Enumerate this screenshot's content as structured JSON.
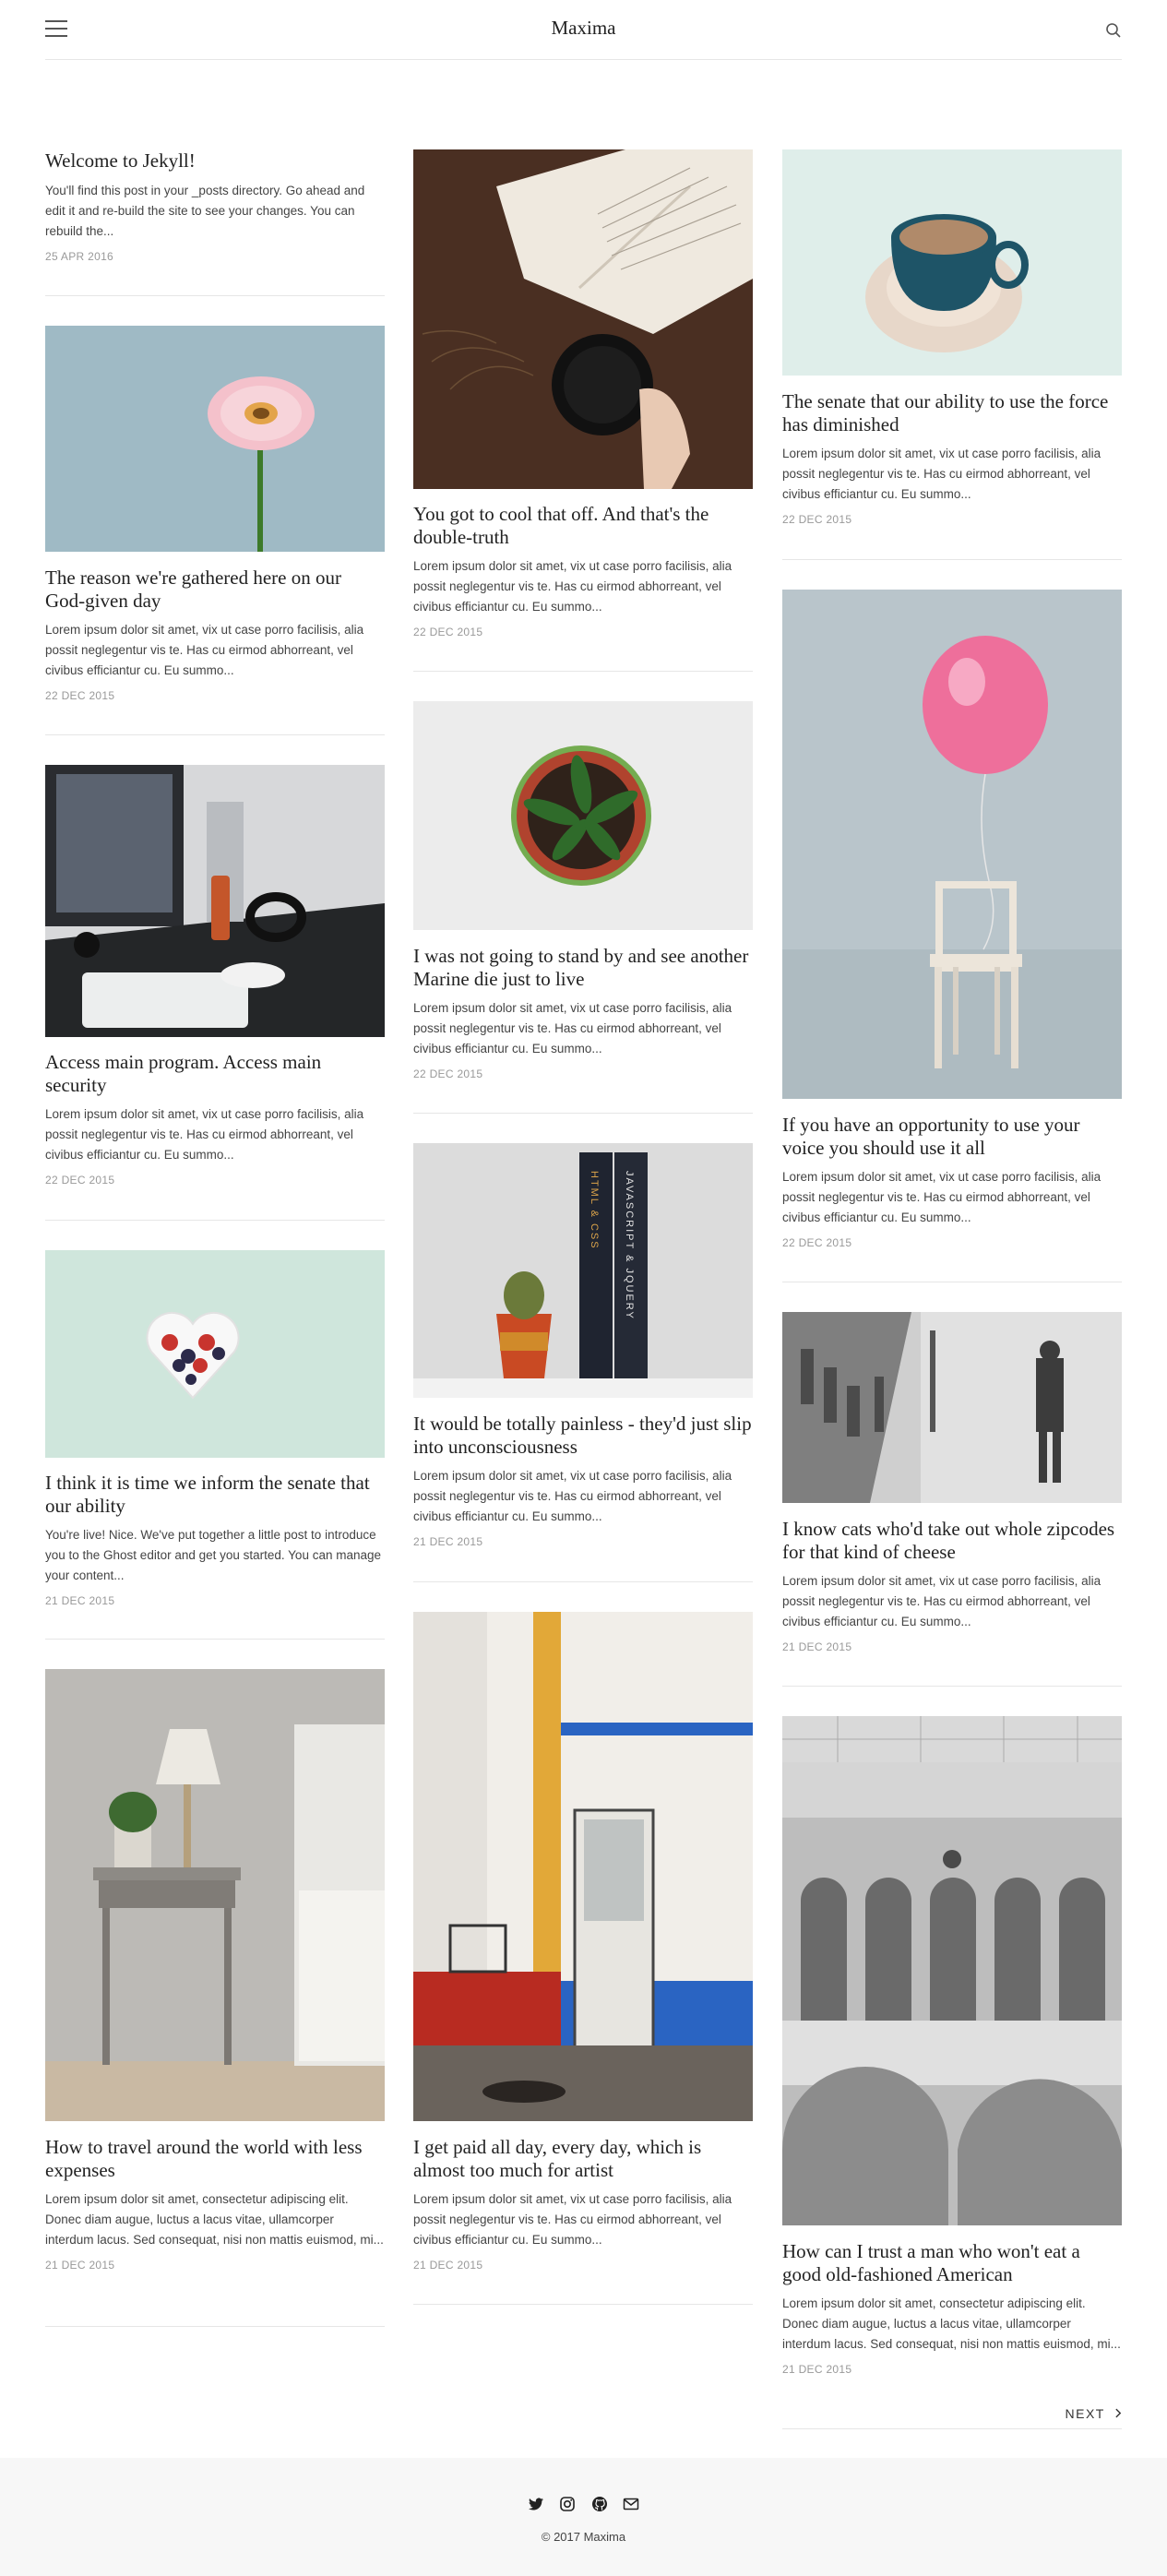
{
  "site": {
    "title": "Maxima",
    "menu_icon": "hamburger-menu-icon",
    "search_icon": "search-icon"
  },
  "posts": [
    {
      "title": "Welcome to Jekyll!",
      "excerpt": "You'll find this post in your _posts directory. Go ahead and edit it and re-build the site to see your changes. You can rebuild the...",
      "date": "25 APR 2016"
    },
    {
      "title": "The reason we're gathered here on our God-given day",
      "excerpt": "Lorem ipsum dolor sit amet, vix ut case porro facilisis, alia possit neglegentur vis te. Has cu eirmod abhorreant, vel civibus efficiantur cu. Eu summo...",
      "date": "22 DEC 2015",
      "image": "pink-gerbera-flower"
    },
    {
      "title": "Access main program. Access main security",
      "excerpt": "Lorem ipsum dolor sit amet, vix ut case porro facilisis, alia possit neglegentur vis te. Has cu eirmod abhorreant, vel civibus efficiantur cu. Eu summo...",
      "date": "22 DEC 2015",
      "image": "desk-with-monitor-and-headphones"
    },
    {
      "title": "I think it is time we inform the senate that our ability",
      "excerpt": "You're live! Nice. We've put together a little post to introduce you to the Ghost editor and get you started. You can manage your content...",
      "date": "21 DEC 2015",
      "image": "heart-bowl-of-berries"
    },
    {
      "title": "How to travel around the world with less expenses",
      "excerpt": "Lorem ipsum dolor sit amet, consectetur adipiscing elit. Donec diam augue, luctus a lacus vitae, ullamcorper interdum lacus. Sed consequat, nisi non mattis euismod, mi...",
      "date": "21 DEC 2015",
      "image": "nightstand-with-lamp"
    },
    {
      "title": "You got to cool that off. And that's the double-truth",
      "excerpt": "Lorem ipsum dolor sit amet, vix ut case porro facilisis, alia possit neglegentur vis te. Has cu eirmod abhorreant, vel civibus efficiantur cu. Eu summo...",
      "date": "22 DEC 2015",
      "image": "book-and-coffee-cup"
    },
    {
      "title": "I was not going to stand by and see another Marine die just to live",
      "excerpt": "Lorem ipsum dolor sit amet, vix ut case porro facilisis, alia possit neglegentur vis te. Has cu eirmod abhorreant, vel civibus efficiantur cu. Eu summo...",
      "date": "22 DEC 2015",
      "image": "potted-plant-top-view"
    },
    {
      "title": "It would be totally painless - they'd just slip into unconsciousness",
      "excerpt": "Lorem ipsum dolor sit amet, vix ut case porro facilisis, alia possit neglegentur vis te. Has cu eirmod abhorreant, vel civibus efficiantur cu. Eu summo...",
      "date": "21 DEC 2015",
      "image": "cactus-and-books",
      "book_spines": [
        "HTML & CSS",
        "JAVASCRIPT & JQUERY"
      ]
    },
    {
      "title": "I get paid all day, every day, which is almost too much for artist",
      "excerpt": "Lorem ipsum dolor sit amet, vix ut case porro facilisis, alia possit neglegentur vis te. Has cu eirmod abhorreant, vel civibus efficiantur cu. Eu summo...",
      "date": "21 DEC 2015",
      "image": "white-building-with-door"
    },
    {
      "title": "The senate that our ability to use the force has diminished",
      "excerpt": "Lorem ipsum dolor sit amet, vix ut case porro facilisis, alia possit neglegentur vis te. Has cu eirmod abhorreant, vel civibus efficiantur cu. Eu summo...",
      "date": "22 DEC 2015",
      "image": "blue-coffee-cup"
    },
    {
      "title": "If you have an opportunity to use your voice you should use it all",
      "excerpt": "Lorem ipsum dolor sit amet, vix ut case porro facilisis, alia possit neglegentur vis te. Has cu eirmod abhorreant, vel civibus efficiantur cu. Eu summo...",
      "date": "22 DEC 2015",
      "image": "pink-balloon-and-chair"
    },
    {
      "title": "I know cats who'd take out whole zipcodes for that kind of cheese",
      "excerpt": "Lorem ipsum dolor sit amet, vix ut case porro facilisis, alia possit neglegentur vis te. Has cu eirmod abhorreant, vel civibus efficiantur cu. Eu summo...",
      "date": "21 DEC 2015",
      "image": "person-walking-in-snow"
    },
    {
      "title": "How can I trust a man who won't eat a good old-fashioned American",
      "excerpt": "Lorem ipsum dolor sit amet, consectetur adipiscing elit. Donec diam augue, luctus a lacus vitae, ullamcorper interdum lacus. Sed consequat, nisi non mattis euismod, mi...",
      "date": "21 DEC 2015",
      "image": "ornate-arched-building"
    }
  ],
  "pagination": {
    "next_label": "NEXT",
    "next_icon": "chevron-right-icon"
  },
  "footer": {
    "social": [
      "twitter-icon",
      "instagram-icon",
      "github-icon",
      "email-icon"
    ],
    "copyright": "© 2017 Maxima"
  },
  "colors": {
    "text": "#222222",
    "muted": "#999999",
    "divider": "#e6e6e6",
    "footer_bg": "#f7f7f7"
  }
}
